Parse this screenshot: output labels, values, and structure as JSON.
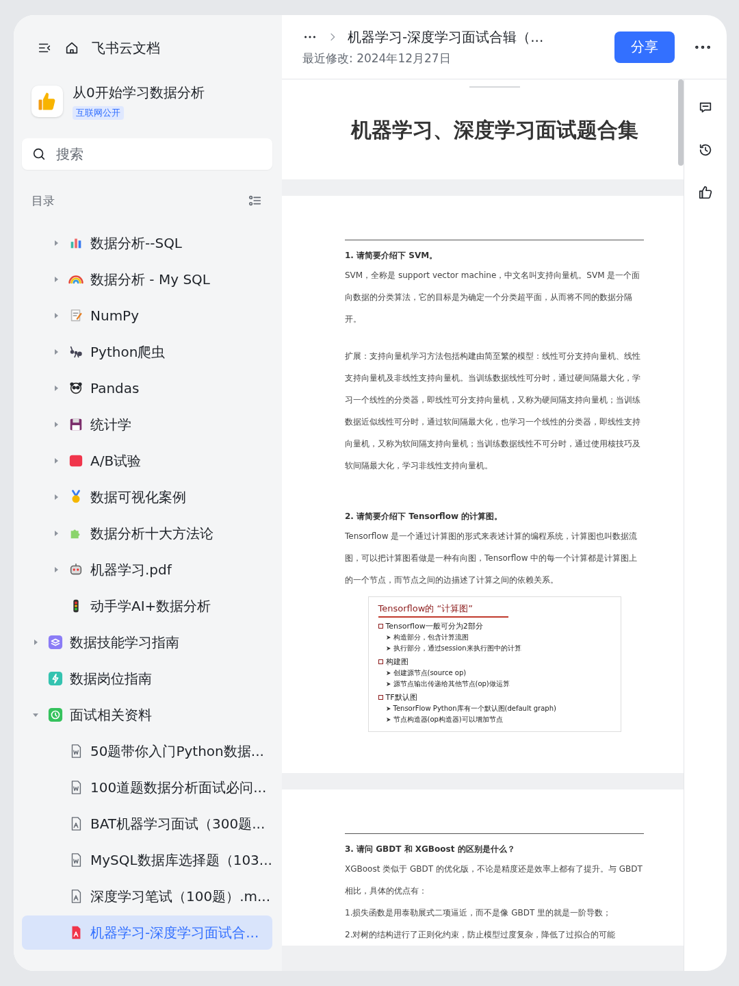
{
  "header": {
    "app_title": "飞书云文档"
  },
  "space": {
    "name": "从0开始学习数据分析",
    "badge": "互联网公开"
  },
  "search": {
    "placeholder": "搜索"
  },
  "toc": {
    "label": "目录"
  },
  "tree": [
    {
      "children": [
        {
          "label": "数据分析--SQL",
          "kind": "chart",
          "expanded": false,
          "selected": false
        },
        {
          "label": "数据分析 - My SQL",
          "kind": "rainbow",
          "expanded": false,
          "selected": false
        },
        {
          "label": "NumPy",
          "kind": "memo",
          "expanded": false,
          "selected": false
        },
        {
          "label": "Python爬虫",
          "kind": "ant",
          "expanded": false,
          "selected": false
        },
        {
          "label": "Pandas",
          "kind": "panda",
          "expanded": false,
          "selected": false
        },
        {
          "label": "统计学",
          "kind": "disk",
          "expanded": false,
          "selected": false
        },
        {
          "label": "A/B试验",
          "kind": "ab",
          "expanded": false,
          "selected": false
        },
        {
          "label": "数据可视化案例",
          "kind": "medal",
          "expanded": false,
          "selected": false
        },
        {
          "label": "数据分析十大方法论",
          "kind": "puzzle",
          "expanded": false,
          "selected": false
        },
        {
          "label": "机器学习.pdf",
          "kind": "robot",
          "expanded": false,
          "selected": false
        },
        {
          "label": "动手学AI+数据分析",
          "kind": "traffic",
          "selected": false
        }
      ]
    },
    {
      "label": "数据技能学习指南",
      "kind": "stack",
      "expanded": false,
      "selected": false
    },
    {
      "label": "数据岗位指南",
      "kind": "bolt",
      "selected": false
    },
    {
      "label": "面试相关资料",
      "kind": "clock",
      "expanded": true,
      "selected": false,
      "children": [
        {
          "label": "50题带你入门Python数据...",
          "kind": "word",
          "selected": false
        },
        {
          "label": "100道题数据分析面试必问...",
          "kind": "word",
          "selected": false
        },
        {
          "label": "BAT机器学习面试（300题...",
          "kind": "pdf",
          "selected": false
        },
        {
          "label": "MySQL数据库选择题（103...",
          "kind": "word",
          "selected": false
        },
        {
          "label": "深度学习笔试（100题）.m...",
          "kind": "pdf",
          "selected": false
        },
        {
          "label": "机器学习-深度学习面试合...",
          "kind": "pdf",
          "selected": true
        }
      ]
    }
  ],
  "topbar": {
    "breadcrumb": "机器学习-深度学习面试合辑（...",
    "modified": "最近修改: 2024年12月27日",
    "share": "分享"
  },
  "pages": [
    {
      "title": "机器学习、深度学习面试题合集"
    },
    {
      "sections": [
        {
          "heading": "1.  请简要介绍下 SVM。",
          "paragraphs": [
            "SVM，全称是 support vector machine，中文名叫支持向量机。SVM 是一个面向数据的分类算法，它的目标是为确定一个分类超平面，从而将不同的数据分隔开。",
            "扩展：支持向量机学习方法包括构建由简至繁的模型：线性可分支持向量机、线性支持向量机及非线性支持向量机。当训练数据线性可分时，通过硬间隔最大化，学习一个线性的分类器，即线性可分支持向量机，又称为硬间隔支持向量机；当训练数据近似线性可分时，通过软间隔最大化，也学习一个线性的分类器，即线性支持向量机，又称为软间隔支持向量机；当训练数据线性不可分时，通过使用核技巧及软间隔最大化，学习非线性支持向量机。"
          ]
        },
        {
          "heading": "2.  请简要介绍下 Tensorflow 的计算图。",
          "paragraphs": [
            "Tensorflow 是一个通过计算图的形式来表述计算的编程系统，计算图也叫数据流图，可以把计算图看做是一种有向图，Tensorflow 中的每一个计算都是计算图上的一个节点，而节点之间的边描述了计算之间的依赖关系。"
          ],
          "figure": {
            "title": "Tensorflow的 “计算图”",
            "bullets": [
              {
                "text": "Tensorflow一般可分为2部分",
                "children": [
                  "构造部分，包含计算流图",
                  "执行部分，通过session来执行图中的计算"
                ]
              },
              {
                "text": "构建图",
                "children": [
                  "创建源节点(source op)",
                  "源节点输出传递给其他节点(op)做运算"
                ]
              },
              {
                "text": "TF默认图",
                "children": [
                  "TensorFlow Python库有一个默认图(default graph)",
                  "节点构造器(op构造器)可以增加节点"
                ]
              }
            ]
          }
        }
      ]
    },
    {
      "sections": [
        {
          "heading": "3.  请问 GBDT 和 XGBoost 的区别是什么？",
          "paragraphs": [
            "XGBoost 类似于 GBDT 的优化版，不论是精度还是效率上都有了提升。与 GBDT 相比，具体的优点有：",
            "1.损失函数是用泰勒展式二项逼近，而不是像 GBDT 里的就是一阶导数；",
            "2.对树的结构进行了正则化约束，防止模型过度复杂，降低了过拟合的可能"
          ]
        }
      ]
    }
  ]
}
